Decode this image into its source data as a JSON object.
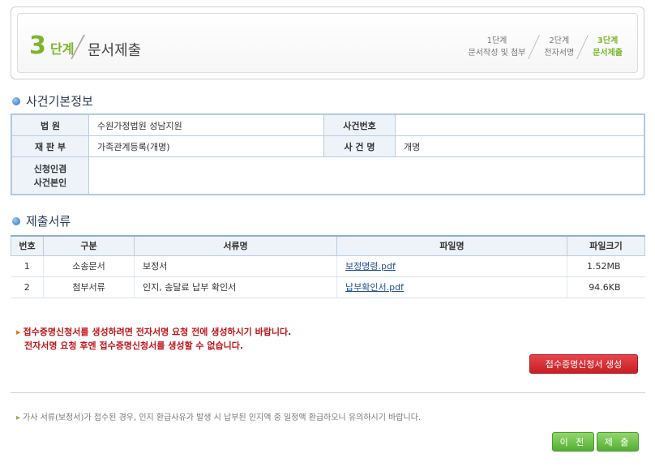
{
  "step": {
    "number": "3",
    "unit": "단계",
    "title": "문서제출",
    "items": [
      {
        "line1": "1단계",
        "line2": "문서작성 및 첨부",
        "active": false
      },
      {
        "line1": "2단계",
        "line2": "전자서명",
        "active": false
      },
      {
        "line1": "3단계",
        "line2": "문서제출",
        "active": true
      }
    ]
  },
  "case_info": {
    "section_title": "사건기본정보",
    "court_label": "법 원",
    "court_value": "수원가정법원 성남지원",
    "case_no_label": "사건번호",
    "case_no_value": "",
    "division_label": "재 판 부",
    "division_value": "가족관계등록(개명)",
    "case_name_label": "사 건 명",
    "case_name_value": "개명",
    "applicant_label_1": "신청인겸",
    "applicant_label_2": "사건본인",
    "applicant_value": ""
  },
  "documents": {
    "section_title": "제출서류",
    "headers": [
      "번호",
      "구분",
      "서류명",
      "파일명",
      "파일크기"
    ],
    "rows": [
      {
        "no": "1",
        "type": "소송문서",
        "name": "보정서",
        "file": "보정명령.pdf",
        "size": "1.52MB"
      },
      {
        "no": "2",
        "type": "첨부서류",
        "name": "인지, 송달료 납부 확인서",
        "file": "납부확인서.pdf",
        "size": "94.6KB"
      }
    ]
  },
  "warning": {
    "line1": "접수증명신청서를 생성하려면 전자서명 요청 전에 생성하시기 바랍니다.",
    "line2": "전자서명 요청 후엔 접수증명신청서를 생성할 수 없습니다."
  },
  "buttons": {
    "generate": "접수증명신청서 생성",
    "prev": "이 전",
    "submit": "제 출"
  },
  "notice": "가사 서류(보정서)가 접수된 경우, 인지 환급사유가 발생 시 납부된 인지액 중 일정액 환급하오니 유의하시기 바랍니다.",
  "colors": {
    "accent_green": "#7cb52b",
    "warning_red": "#c0141a",
    "button_red": "#d7333a",
    "button_green": "#6cc24a"
  }
}
